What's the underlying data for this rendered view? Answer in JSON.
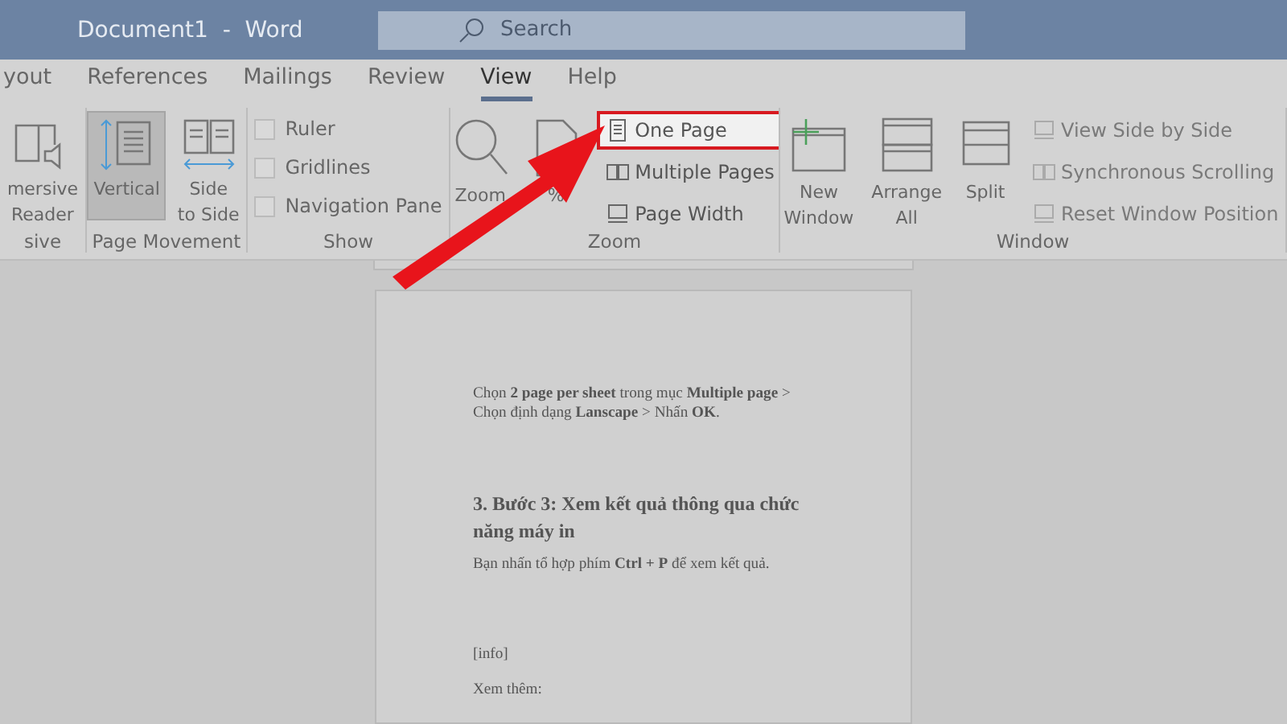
{
  "window": {
    "title": "Document1  -  Word"
  },
  "search": {
    "placeholder": "Search"
  },
  "tabs": [
    {
      "label": "yout",
      "selected": false
    },
    {
      "label": "References",
      "selected": false
    },
    {
      "label": "Mailings",
      "selected": false
    },
    {
      "label": "Review",
      "selected": false
    },
    {
      "label": "View",
      "selected": true
    },
    {
      "label": "Help",
      "selected": false
    }
  ],
  "ribbon_groups": [
    {
      "label": "sive",
      "items": [
        {
          "kind": "large",
          "label": "mersive\nReader",
          "selected": false
        }
      ]
    },
    {
      "label": "Page Movement",
      "items": [
        {
          "kind": "large",
          "label": "Vertical",
          "selected": true
        },
        {
          "kind": "large",
          "label": "Side\nto Side",
          "selected": false
        }
      ]
    },
    {
      "label": "Show",
      "items": [
        {
          "kind": "check",
          "label": "Ruler",
          "checked": false
        },
        {
          "kind": "check",
          "label": "Gridlines",
          "checked": false
        },
        {
          "kind": "check",
          "label": "Navigation Pane",
          "checked": false
        }
      ]
    },
    {
      "label": "Zoom",
      "items": [
        {
          "kind": "large",
          "label": "Zoom",
          "selected": false
        },
        {
          "kind": "large",
          "label": "%",
          "selected": false
        },
        {
          "kind": "small",
          "label": "One Page",
          "highlighted": true,
          "disabled": false
        },
        {
          "kind": "small",
          "label": "Multiple Pages",
          "highlighted": false,
          "disabled": false
        },
        {
          "kind": "small",
          "label": "Page Width",
          "highlighted": false,
          "disabled": false
        }
      ]
    },
    {
      "label": "Window",
      "items": [
        {
          "kind": "large",
          "label": "New\nWindow",
          "selected": false
        },
        {
          "kind": "large",
          "label": "Arrange\nAll",
          "selected": false
        },
        {
          "kind": "large",
          "label": "Split",
          "selected": false
        },
        {
          "kind": "small",
          "label": "View Side by Side",
          "highlighted": false,
          "disabled": true
        },
        {
          "kind": "small",
          "label": "Synchronous Scrolling",
          "highlighted": false,
          "disabled": true
        },
        {
          "kind": "small",
          "label": "Reset Window Position",
          "highlighted": false,
          "disabled": true
        }
      ]
    }
  ],
  "document": [
    {
      "kind": "para",
      "text": "Chọn **2 page per sheet** trong mục **Multiple page** >\nChọn định dạng **Lanscape** > Nhấn **OK**."
    },
    {
      "kind": "heading",
      "text": "3. Bước 3: Xem kết quả thông qua chức\nnăng máy in"
    },
    {
      "kind": "para",
      "text": "Bạn nhấn tổ hợp phím **Ctrl + P** để xem kết quả."
    },
    {
      "kind": "para",
      "text": "[info]"
    },
    {
      "kind": "para",
      "text": "Xem thêm:"
    }
  ]
}
